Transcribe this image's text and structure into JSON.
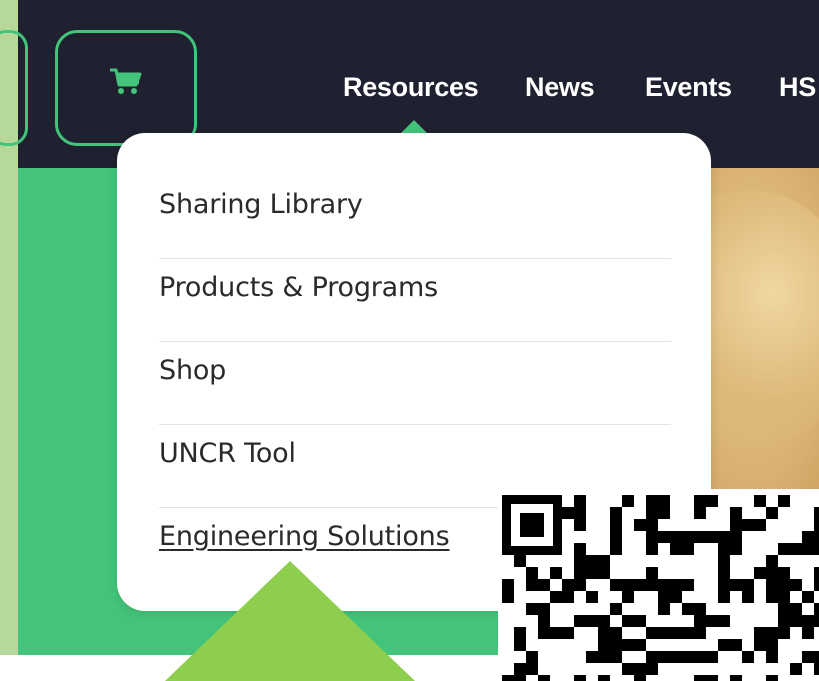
{
  "nav": {
    "links": [
      "Resources",
      "News",
      "Events",
      "HS"
    ]
  },
  "dropdown": {
    "items": [
      "Sharing Library",
      "Products & Programs",
      "Shop",
      "UNCR Tool",
      "Engineering Solutions"
    ]
  },
  "icons": {
    "cart": "shopping-cart-icon",
    "qr": "qr-code-icon"
  },
  "colors": {
    "topbar": "#1f2130",
    "brand_green": "#43c47a",
    "triangle_green": "#8dce4f",
    "left_strip": "#b6d89a"
  }
}
